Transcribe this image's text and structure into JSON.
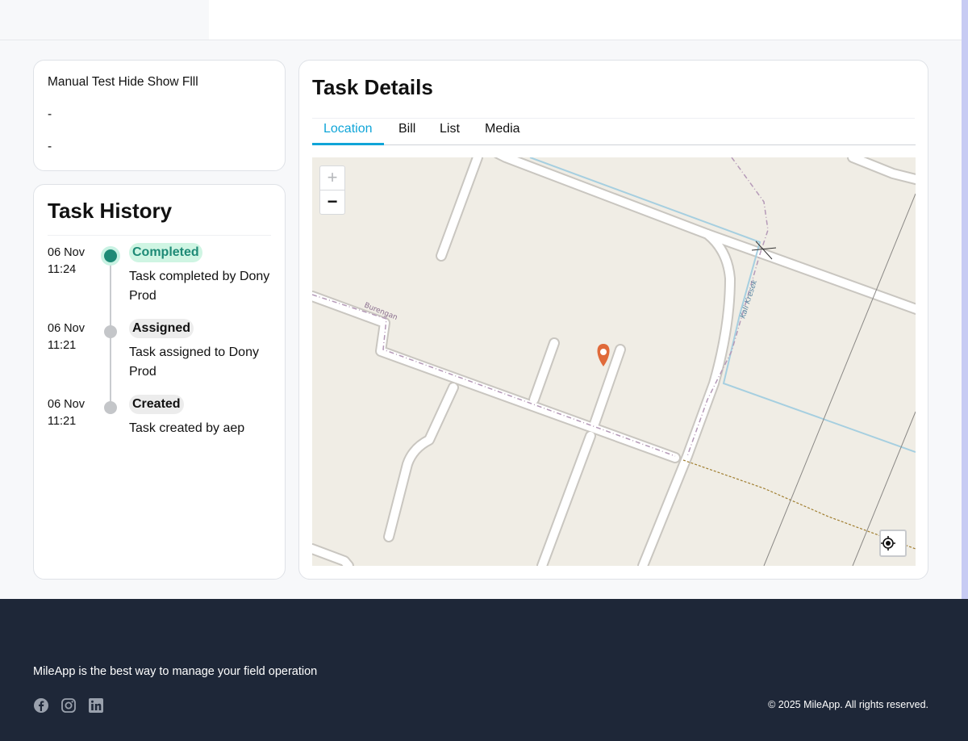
{
  "summary": {
    "title": "Manual Test Hide Show Flll",
    "line2": "-",
    "line3": "-"
  },
  "history": {
    "title": "Task History",
    "items": [
      {
        "date": "06 Nov",
        "time": "11:24",
        "status": "Completed",
        "text": "Task completed by Dony Prod"
      },
      {
        "date": "06 Nov",
        "time": "11:21",
        "status": "Assigned",
        "text": "Task assigned to Dony Prod"
      },
      {
        "date": "06 Nov",
        "time": "11:21",
        "status": "Created",
        "text": "Task created by aep"
      }
    ]
  },
  "details": {
    "title": "Task Details",
    "tabs": [
      "Location",
      "Bill",
      "List",
      "Media"
    ],
    "active_tab": "Location"
  },
  "map": {
    "zoom_in": "+",
    "zoom_out": "−",
    "street_labels": [
      "Burengan",
      "Kali Kresek"
    ],
    "marker_color": "#e06a3a",
    "locate_icon": "crosshair-icon"
  },
  "footer": {
    "tagline": "MileApp is the best way to manage your field operation",
    "socials": [
      "facebook-icon",
      "instagram-icon",
      "linkedin-icon"
    ],
    "copyright": "© 2025 MileApp. All rights reserved."
  },
  "colors": {
    "accent": "#10a5d8",
    "completed": "#1e8a76",
    "footer_bg": "#1e2738"
  }
}
